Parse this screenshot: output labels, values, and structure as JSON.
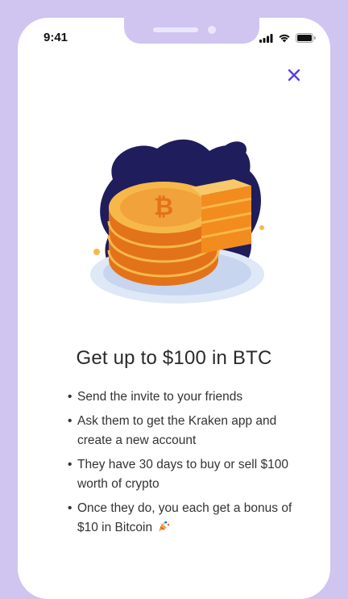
{
  "status_bar": {
    "time": "9:41"
  },
  "close_button": {
    "icon": "close-icon"
  },
  "promo": {
    "title": "Get up to $100 in BTC",
    "bullets": [
      "Send the invite to your friends",
      "Ask them to get the Kraken app and create a new account",
      "They have 30 days to buy or sell $100 worth of crypto",
      "Once they do, you each get a bonus of $10 in Bitcoin"
    ],
    "bullet_emoji": "party-popper-icon"
  },
  "colors": {
    "frame": "#cfc5f0",
    "accent": "#5a3ee0",
    "coin_orange": "#f28c1e",
    "coin_light": "#f7b84a",
    "blob_navy": "#1f1d5c"
  }
}
